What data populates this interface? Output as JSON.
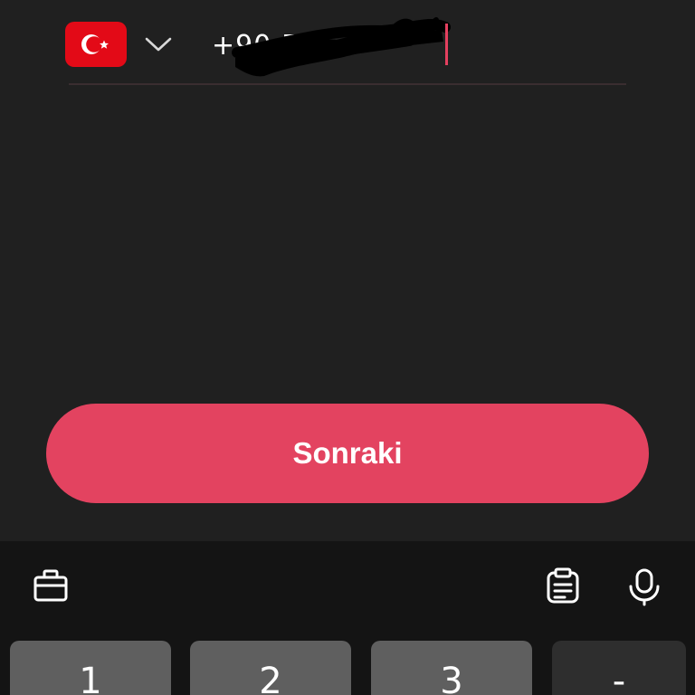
{
  "phone": {
    "country_flag": "turkey-flag",
    "dial_prefix": "+90 5",
    "flag_color": "#e30a17"
  },
  "actions": {
    "next_label": "Sonraki",
    "next_color": "#e34360"
  },
  "keyboard": {
    "keys": [
      "1",
      "2",
      "3",
      "-"
    ]
  }
}
